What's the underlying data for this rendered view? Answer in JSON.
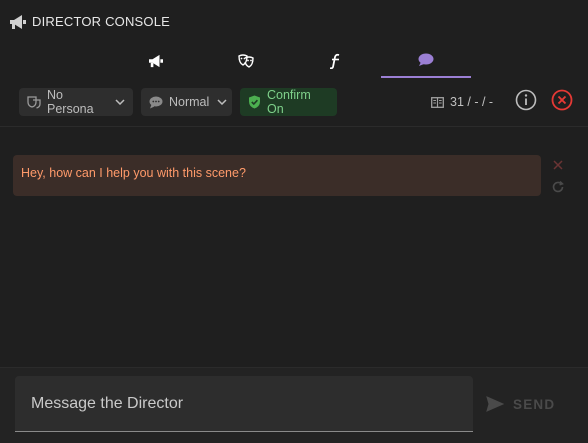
{
  "header": {
    "title": "DIRECTOR CONSOLE",
    "icon": "megaphone-icon"
  },
  "tabs": [
    {
      "icon": "megaphone-icon",
      "active": false
    },
    {
      "icon": "drama-masks-icon",
      "active": false
    },
    {
      "icon": "function-icon",
      "active": false
    },
    {
      "icon": "chat-bubble-icon",
      "active": true
    }
  ],
  "toolbar": {
    "persona": {
      "label": "No Persona",
      "icon": "persona-icon"
    },
    "mode": {
      "label": "Normal",
      "icon": "speech-bubble-icon"
    },
    "confirm": {
      "label": "Confirm On",
      "icon": "shield-check-icon"
    },
    "counter": {
      "value": "31 / - / -",
      "icon": "book-icon"
    }
  },
  "messages": [
    {
      "text": "Hey, how can I help you with this scene?"
    }
  ],
  "composer": {
    "placeholder": "Message the Director",
    "value": "",
    "send_label": "SEND"
  },
  "colors": {
    "accent": "#9b7fd4",
    "confirm_text": "#7ed08a",
    "message_text": "#ff9a6a",
    "message_bg": "#3b2d28",
    "close_red": "#e53935"
  }
}
